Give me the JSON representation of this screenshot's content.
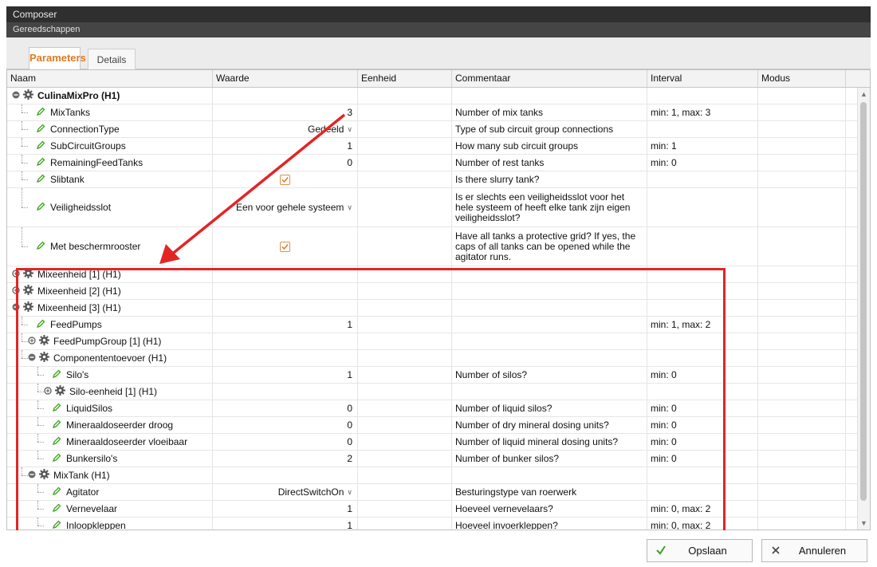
{
  "window": {
    "title": "Composer",
    "menu": "Gereedschappen"
  },
  "tabs": [
    {
      "label": "Parameters",
      "active": true
    },
    {
      "label": "Details",
      "active": false
    }
  ],
  "columns": [
    "Naam",
    "Waarde",
    "Eenheid",
    "Commentaar",
    "Interval",
    "Modus"
  ],
  "rows": [
    {
      "name": "CulinaMixPro (H1)",
      "kind": "group",
      "expander": "minus",
      "level": 0,
      "bold": true
    },
    {
      "name": "MixTanks",
      "kind": "param",
      "level": 1,
      "value": "3",
      "comment": "Number of mix tanks",
      "interval": "min: 1, max: 3"
    },
    {
      "name": "ConnectionType",
      "kind": "param",
      "level": 1,
      "value": "Gedeeld",
      "dropdown": true,
      "comment": "Type of sub circuit group connections"
    },
    {
      "name": "SubCircuitGroups",
      "kind": "param",
      "level": 1,
      "value": "1",
      "comment": "How many sub circuit groups",
      "interval": "min: 1"
    },
    {
      "name": "RemainingFeedTanks",
      "kind": "param",
      "level": 1,
      "value": "0",
      "comment": "Number of rest tanks",
      "interval": "min: 0"
    },
    {
      "name": "Slibtank",
      "kind": "param",
      "level": 1,
      "checkbox": true,
      "checked": true,
      "comment": "Is there slurry tank?"
    },
    {
      "name": "Veiligheidsslot",
      "kind": "param",
      "level": 1,
      "value": "Een voor gehele systeem",
      "dropdown": true,
      "comment": "Is er slechts een veiligheidsslot voor het hele systeem of heeft elke tank zijn eigen veiligheidsslot?",
      "tall": true
    },
    {
      "name": "Met beschermrooster",
      "kind": "param",
      "level": 1,
      "checkbox": true,
      "checked": true,
      "comment": "Have all tanks a protective grid? If yes, the caps of all tanks can be opened while the agitator runs.",
      "tall": true
    },
    {
      "name": "Mixeenheid [1] (H1)",
      "kind": "group",
      "expander": "plus",
      "level": 0
    },
    {
      "name": "Mixeenheid [2] (H1)",
      "kind": "group",
      "expander": "plus",
      "level": 0
    },
    {
      "name": "Mixeenheid [3] (H1)",
      "kind": "group",
      "expander": "minus",
      "level": 0
    },
    {
      "name": "FeedPumps",
      "kind": "param",
      "level": 1,
      "value": "1",
      "interval": "min: 1, max: 2"
    },
    {
      "name": "FeedPumpGroup [1] (H1)",
      "kind": "group",
      "expander": "plus",
      "level": 1
    },
    {
      "name": "Componententoevoer (H1)",
      "kind": "group",
      "expander": "minus",
      "level": 1
    },
    {
      "name": "Silo's",
      "kind": "param",
      "level": 2,
      "value": "1",
      "comment": "Number of silos?",
      "interval": "min: 0"
    },
    {
      "name": "Silo-eenheid [1] (H1)",
      "kind": "group",
      "expander": "plus",
      "level": 2
    },
    {
      "name": "LiquidSilos",
      "kind": "param",
      "level": 2,
      "value": "0",
      "comment": "Number of liquid silos?",
      "interval": "min: 0"
    },
    {
      "name": "Mineraaldoseerder droog",
      "kind": "param",
      "level": 2,
      "value": "0",
      "comment": "Number of dry mineral dosing units?",
      "interval": "min: 0"
    },
    {
      "name": "Mineraaldoseerder vloeibaar",
      "kind": "param",
      "level": 2,
      "value": "0",
      "comment": "Number of liquid mineral dosing units?",
      "interval": "min: 0"
    },
    {
      "name": "Bunkersilo's",
      "kind": "param",
      "level": 2,
      "value": "2",
      "comment": "Number of bunker silos?",
      "interval": "min: 0"
    },
    {
      "name": "MixTank (H1)",
      "kind": "group",
      "expander": "minus",
      "level": 1
    },
    {
      "name": "Agitator",
      "kind": "param",
      "level": 2,
      "value": "DirectSwitchOn",
      "dropdown": true,
      "comment": "Besturingstype van roerwerk"
    },
    {
      "name": "Vernevelaar",
      "kind": "param",
      "level": 2,
      "value": "1",
      "comment": "Hoeveel vernevelaars?",
      "interval": "min: 0, max: 2"
    },
    {
      "name": "Inloopkleppen",
      "kind": "param",
      "level": 2,
      "value": "1",
      "comment": "Hoeveel invoerkleppen?",
      "interval": "min: 0, max: 2"
    }
  ],
  "buttons": {
    "save": "Opslaan",
    "cancel": "Annuleren"
  },
  "colors": {
    "accent": "#e07a1f",
    "highlight": "#e32525",
    "pencil": "#3aa31e",
    "save_check": "#3aa31e"
  }
}
